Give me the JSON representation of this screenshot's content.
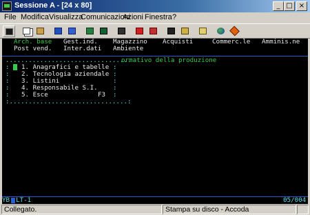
{
  "window": {
    "title": "Sessione A - [24 x 80]",
    "min_glyph": "_",
    "max_glyph": "□",
    "close_glyph": "×"
  },
  "menu": {
    "file": "File",
    "modifica": "Modifica",
    "visualizza": "Visualizza",
    "comunicazioni": "Comunicazioni",
    "azioni": "Azioni",
    "finestra": "Finestra",
    "help": "?"
  },
  "toolbar": {
    "icons": [
      "print-screen",
      "copy",
      "paste",
      "send",
      "receive",
      "display",
      "color-map",
      "keyboard-map",
      "macro-record",
      "macro-stop",
      "macro-play",
      "macro-next",
      "clipboard",
      "globe",
      "tag"
    ]
  },
  "terminal": {
    "nav_row1": [
      "Arch. base",
      "Gest.ind.",
      "Magazzino",
      "Acquisti",
      "Commerc.le",
      "Amminis.ne"
    ],
    "nav_row2": [
      "Post vend.",
      "Inter.dati",
      "Ambiente"
    ],
    "menu_title": "ormativo della produzione",
    "menu_items": [
      "1. Anagrafici e tabelle",
      "2. Tecnologia aziendale",
      "3. Listini",
      "4. Responsabile S.I.",
      "5. Esce"
    ],
    "exit_key": "F3",
    "oia_left": "YB",
    "oia_mid": "LT-1",
    "oia_right": "05/004"
  },
  "status": {
    "left": "Collegato.",
    "right": "Stampa su disco - Accoda"
  },
  "colors": {
    "terminal_bg": "#000000",
    "terminal_green": "#36c946",
    "terminal_cyan": "#55e0f0",
    "titlebar_start": "#0a246a",
    "titlebar_end": "#a6caf0"
  }
}
